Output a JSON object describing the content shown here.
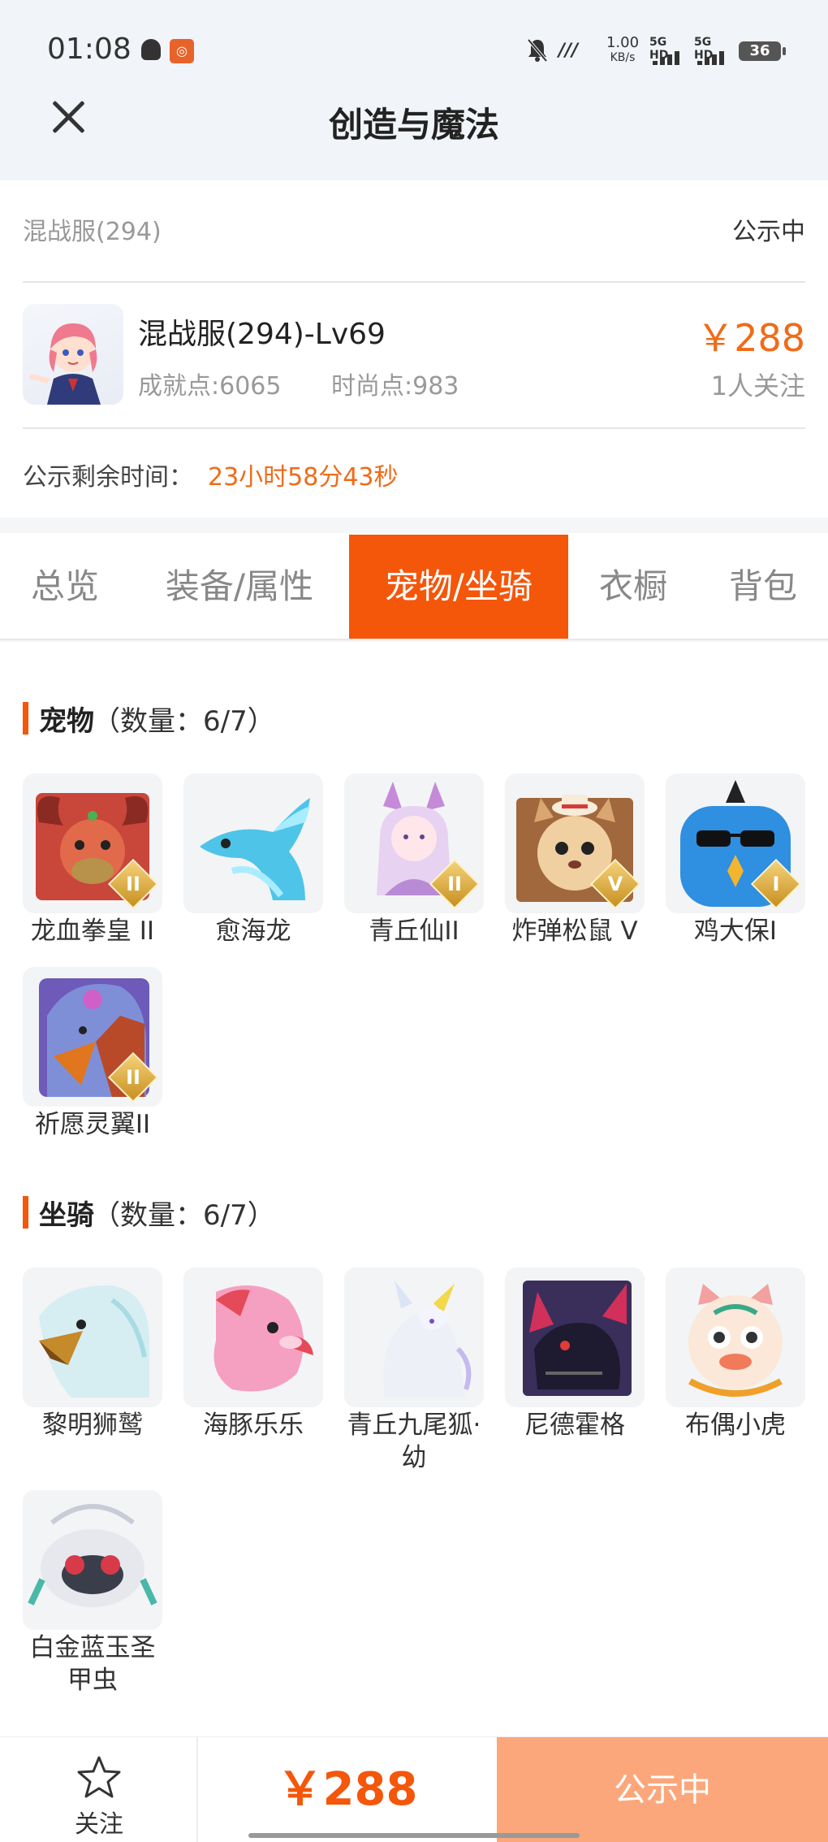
{
  "status_bar": {
    "time": "01:08",
    "net_speed_value": "1.00",
    "net_speed_unit": "KB/s",
    "signal1_label": "5G HD",
    "signal2_label": "5G HD",
    "battery": "36"
  },
  "header": {
    "title": "创造与魔法"
  },
  "listing": {
    "server": "混战服(294)",
    "status": "公示中",
    "character_name": "混战服(294)-Lv69",
    "achievement": "成就点:6065",
    "fashion": "时尚点:983",
    "price": "￥288",
    "followers": "1人关注",
    "remain_label": "公示剩余时间：",
    "remain_value": "23小时58分43秒"
  },
  "tabs": [
    {
      "label": "总览"
    },
    {
      "label": "装备/属性"
    },
    {
      "label": "宠物/坐骑"
    },
    {
      "label": "衣橱"
    },
    {
      "label": "背包"
    }
  ],
  "pets_section": {
    "name": "宠物",
    "count": "（数量：6/7）",
    "items": [
      {
        "label": "龙血拳皇 II",
        "tier": "II",
        "icon": "red-dragon-pet-icon"
      },
      {
        "label": "愈海龙",
        "tier": "",
        "icon": "sea-dragon-pet-icon"
      },
      {
        "label": "青丘仙II",
        "tier": "II",
        "icon": "fox-fairy-pet-icon"
      },
      {
        "label": "炸弹松鼠 V",
        "tier": "V",
        "icon": "bomb-squirrel-pet-icon"
      },
      {
        "label": "鸡大保I",
        "tier": "I",
        "icon": "blue-chicken-pet-icon"
      },
      {
        "label": "祈愿灵翼II",
        "tier": "II",
        "icon": "wish-griffin-pet-icon"
      }
    ]
  },
  "mounts_section": {
    "name": "坐骑",
    "count": "（数量：6/7）",
    "items": [
      {
        "label": "黎明狮鹫",
        "icon": "dawn-griffin-mount-icon"
      },
      {
        "label": "海豚乐乐",
        "icon": "pink-dolphin-mount-icon"
      },
      {
        "label": "青丘九尾狐·幼",
        "icon": "nine-tail-fox-mount-icon"
      },
      {
        "label": "尼德霍格",
        "icon": "dark-dragon-mount-icon"
      },
      {
        "label": "布偶小虎",
        "icon": "toy-tiger-mount-icon"
      },
      {
        "label": "白金蓝玉圣甲虫",
        "icon": "scarab-mount-icon"
      }
    ]
  },
  "bottom_bar": {
    "follow_label": "关注",
    "price": "￥288",
    "status": "公示中"
  },
  "colors": {
    "accent": "#f4560a",
    "price": "#ef6b1a",
    "status_button": "#fba77b"
  }
}
